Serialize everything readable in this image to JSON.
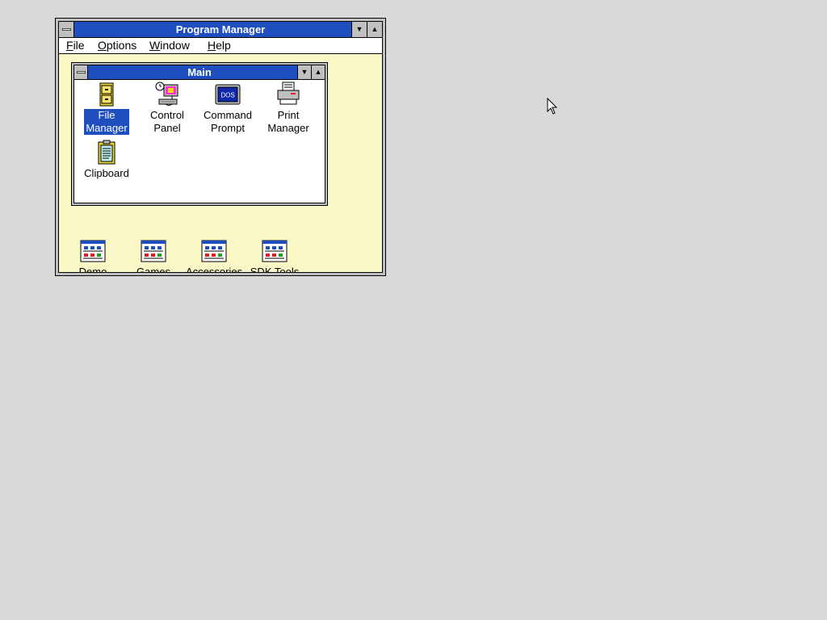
{
  "program_manager": {
    "title": "Program Manager",
    "menu": [
      {
        "label": "File",
        "underline": "F",
        "rest": "ile"
      },
      {
        "label": "Options",
        "underline": "O",
        "rest": "ptions"
      },
      {
        "label": "Window",
        "underline": "W",
        "rest": "indow"
      },
      {
        "label": "Help",
        "underline": "H",
        "rest": "elp"
      }
    ],
    "main_group": {
      "title": "Main",
      "icons": [
        {
          "line1": "File",
          "line2": "Manager",
          "icon": "file-cabinet-icon",
          "selected": true
        },
        {
          "line1": "Control",
          "line2": "Panel",
          "icon": "control-panel-icon"
        },
        {
          "line1": "Command",
          "line2": "Prompt",
          "icon": "dos-prompt-icon"
        },
        {
          "line1": "Print",
          "line2": "Manager",
          "icon": "printer-icon"
        },
        {
          "line1": "Clipboard",
          "line2": "",
          "icon": "clipboard-icon"
        }
      ]
    },
    "group_icons": [
      {
        "label": "Demo",
        "icon": "program-group-icon"
      },
      {
        "label": "Games",
        "icon": "program-group-icon"
      },
      {
        "label": "Accessories",
        "icon": "program-group-icon"
      },
      {
        "label": "SDK Tools",
        "icon": "program-group-icon"
      }
    ],
    "dos_text": "DOS",
    "colors": {
      "titlebar": "#1f4fbf",
      "desktop": "#d9d9d9",
      "workspace": "#fbf8c8"
    }
  }
}
